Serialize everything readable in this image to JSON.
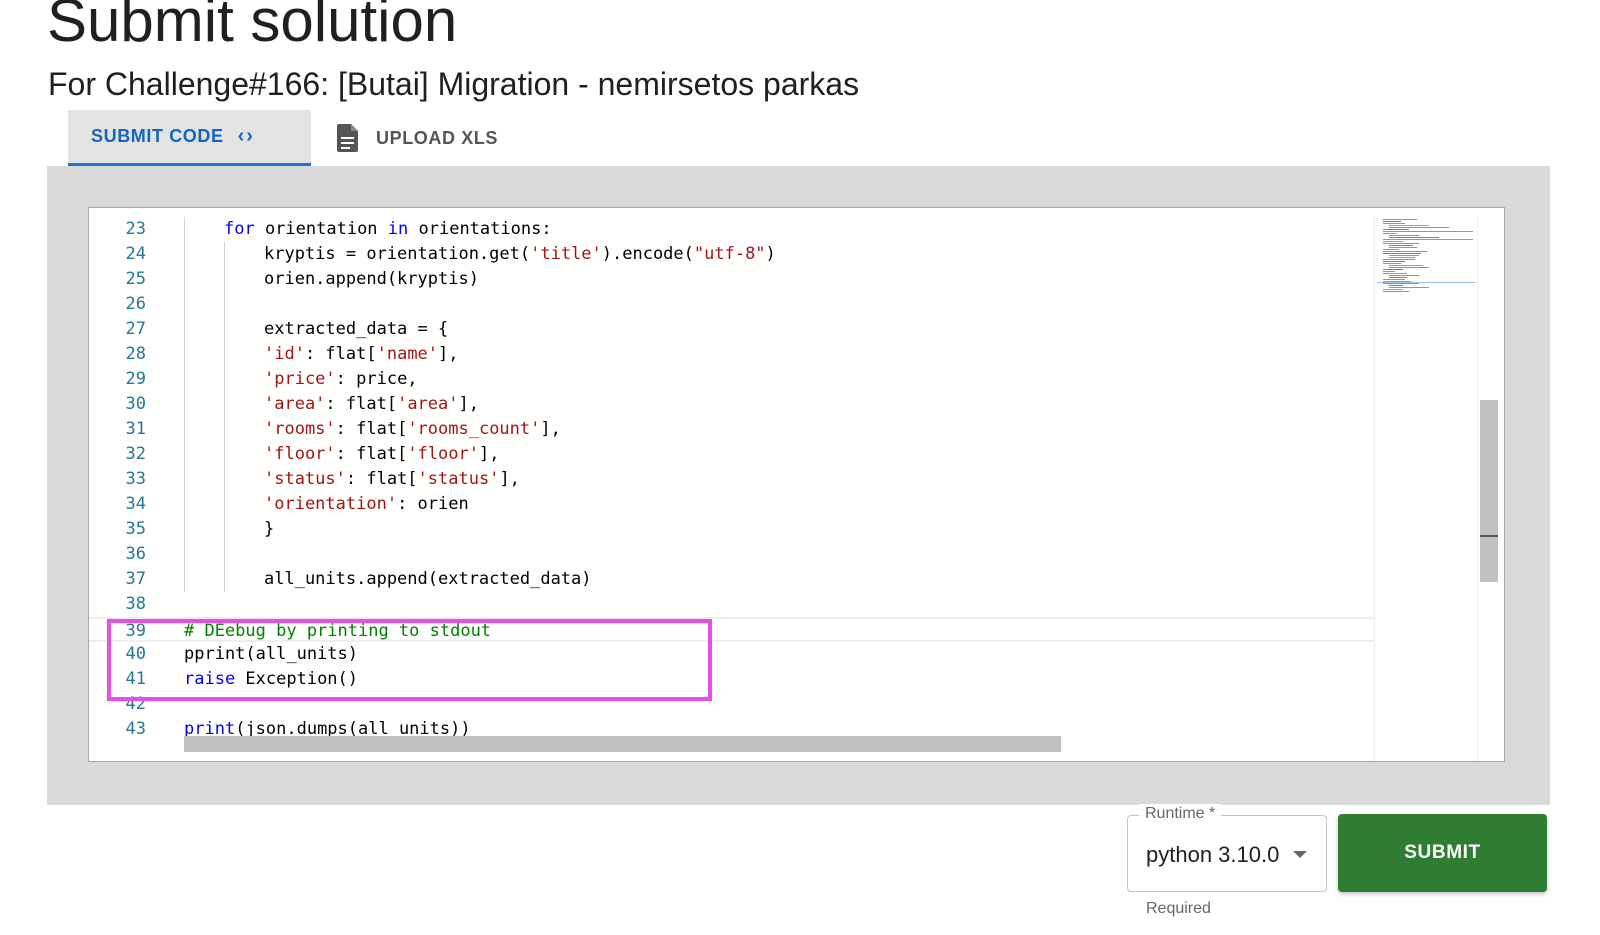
{
  "page": {
    "title": "Submit solution",
    "subtitle": "For Challenge#166: [Butai] Migration - nemirsetos parkas"
  },
  "tabs": [
    {
      "label": "SUBMIT CODE",
      "icon": "code-icon",
      "selected": true
    },
    {
      "label": "UPLOAD XLS",
      "icon": "document-icon",
      "selected": false
    }
  ],
  "editor": {
    "language": "python",
    "lines": [
      {
        "number": "23",
        "indent": 1,
        "tokens": [
          {
            "t": "kw",
            "v": "for"
          },
          {
            "t": "plain",
            "v": " orientation "
          },
          {
            "t": "kw",
            "v": "in"
          },
          {
            "t": "plain",
            "v": " orientations:"
          }
        ]
      },
      {
        "number": "24",
        "indent": 2,
        "tokens": [
          {
            "t": "plain",
            "v": "kryptis = orientation.get("
          },
          {
            "t": "str",
            "v": "'title'"
          },
          {
            "t": "plain",
            "v": ").encode("
          },
          {
            "t": "str",
            "v": "\"utf-8\""
          },
          {
            "t": "plain",
            "v": ")"
          }
        ]
      },
      {
        "number": "25",
        "indent": 2,
        "tokens": [
          {
            "t": "plain",
            "v": "orien.append(kryptis)"
          }
        ]
      },
      {
        "number": "26",
        "indent": 2,
        "tokens": []
      },
      {
        "number": "27",
        "indent": 2,
        "tokens": [
          {
            "t": "plain",
            "v": "extracted_data = {"
          }
        ]
      },
      {
        "number": "28",
        "indent": 2,
        "tokens": [
          {
            "t": "str",
            "v": "'id'"
          },
          {
            "t": "plain",
            "v": ": flat["
          },
          {
            "t": "str",
            "v": "'name'"
          },
          {
            "t": "plain",
            "v": "],"
          }
        ]
      },
      {
        "number": "29",
        "indent": 2,
        "tokens": [
          {
            "t": "str",
            "v": "'price'"
          },
          {
            "t": "plain",
            "v": ": price,"
          }
        ]
      },
      {
        "number": "30",
        "indent": 2,
        "tokens": [
          {
            "t": "str",
            "v": "'area'"
          },
          {
            "t": "plain",
            "v": ": flat["
          },
          {
            "t": "str",
            "v": "'area'"
          },
          {
            "t": "plain",
            "v": "],"
          }
        ]
      },
      {
        "number": "31",
        "indent": 2,
        "tokens": [
          {
            "t": "str",
            "v": "'rooms'"
          },
          {
            "t": "plain",
            "v": ": flat["
          },
          {
            "t": "str",
            "v": "'rooms_count'"
          },
          {
            "t": "plain",
            "v": "],"
          }
        ]
      },
      {
        "number": "32",
        "indent": 2,
        "tokens": [
          {
            "t": "str",
            "v": "'floor'"
          },
          {
            "t": "plain",
            "v": ": flat["
          },
          {
            "t": "str",
            "v": "'floor'"
          },
          {
            "t": "plain",
            "v": "],"
          }
        ]
      },
      {
        "number": "33",
        "indent": 2,
        "tokens": [
          {
            "t": "str",
            "v": "'status'"
          },
          {
            "t": "plain",
            "v": ": flat["
          },
          {
            "t": "str",
            "v": "'status'"
          },
          {
            "t": "plain",
            "v": "],"
          }
        ]
      },
      {
        "number": "34",
        "indent": 2,
        "tokens": [
          {
            "t": "str",
            "v": "'orientation'"
          },
          {
            "t": "plain",
            "v": ": orien"
          }
        ]
      },
      {
        "number": "35",
        "indent": 2,
        "tokens": [
          {
            "t": "plain",
            "v": "}"
          }
        ]
      },
      {
        "number": "36",
        "indent": 2,
        "tokens": []
      },
      {
        "number": "37",
        "indent": 2,
        "tokens": [
          {
            "t": "plain",
            "v": "all_units.append(extracted_data)"
          }
        ]
      },
      {
        "number": "38",
        "indent": 0,
        "tokens": []
      },
      {
        "number": "39",
        "indent": 0,
        "tokens": [
          {
            "t": "comment",
            "v": "# DEebug by printing to stdout"
          }
        ]
      },
      {
        "number": "40",
        "indent": 0,
        "tokens": [
          {
            "t": "plain",
            "v": "pprint(all_units)"
          }
        ]
      },
      {
        "number": "41",
        "indent": 0,
        "tokens": [
          {
            "t": "kw",
            "v": "raise"
          },
          {
            "t": "plain",
            "v": " Exception()"
          }
        ]
      },
      {
        "number": "42",
        "indent": 0,
        "tokens": []
      },
      {
        "number": "43",
        "indent": 0,
        "tokens": [
          {
            "t": "kw",
            "v": "print"
          },
          {
            "t": "plain",
            "v": "(json.dumps(all_units))"
          }
        ]
      }
    ]
  },
  "runtime": {
    "label": "Runtime *",
    "value": "python 3.10.0",
    "helper": "Required"
  },
  "submit": {
    "label": "SUBMIT"
  },
  "colors": {
    "accent": "#1976d2",
    "submit_green": "#2e7d32",
    "highlight_magenta": "#e94de9",
    "keyword": "#0000ff",
    "string": "#a31515",
    "comment": "#008000",
    "line_number": "#237893"
  }
}
